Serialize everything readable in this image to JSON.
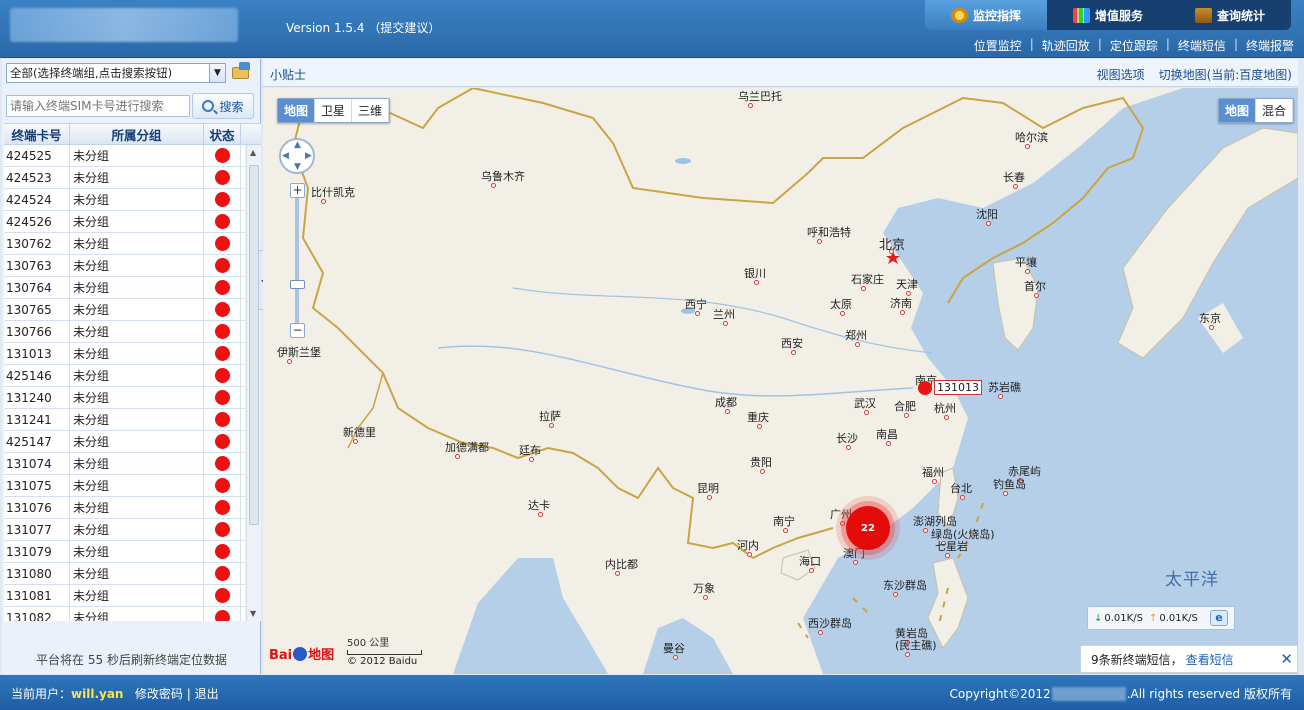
{
  "header": {
    "version": "Version 1.5.4",
    "suggest": "（提交建议）",
    "tabs": [
      {
        "label": "监控指挥",
        "icon": "monitor-icon",
        "active": true
      },
      {
        "label": "增值服务",
        "icon": "chart-icon"
      },
      {
        "label": "查询统计",
        "icon": "briefcase-icon"
      }
    ],
    "subnav": [
      "位置监控",
      "轨迹回放",
      "定位跟踪",
      "终端短信",
      "终端报警"
    ]
  },
  "sidebar": {
    "group_select": "全部(选择终端组,点击搜索按钮)",
    "search_placeholder": "请输入终端SIM卡号进行搜索",
    "search_btn": "搜索",
    "columns": [
      "终端卡号",
      "所属分组",
      "状态"
    ],
    "rows": [
      {
        "id": "424525",
        "group": "未分组"
      },
      {
        "id": "424523",
        "group": "未分组"
      },
      {
        "id": "424524",
        "group": "未分组"
      },
      {
        "id": "424526",
        "group": "未分组"
      },
      {
        "id": "130762",
        "group": "未分组"
      },
      {
        "id": "130763",
        "group": "未分组"
      },
      {
        "id": "130764",
        "group": "未分组"
      },
      {
        "id": "130765",
        "group": "未分组"
      },
      {
        "id": "130766",
        "group": "未分组"
      },
      {
        "id": "131013",
        "group": "未分组"
      },
      {
        "id": "425146",
        "group": "未分组"
      },
      {
        "id": "131240",
        "group": "未分组"
      },
      {
        "id": "131241",
        "group": "未分组"
      },
      {
        "id": "425147",
        "group": "未分组"
      },
      {
        "id": "131074",
        "group": "未分组"
      },
      {
        "id": "131075",
        "group": "未分组"
      },
      {
        "id": "131076",
        "group": "未分组"
      },
      {
        "id": "131077",
        "group": "未分组"
      },
      {
        "id": "131079",
        "group": "未分组"
      },
      {
        "id": "131080",
        "group": "未分组"
      },
      {
        "id": "131081",
        "group": "未分组"
      },
      {
        "id": "131082",
        "group": "未分组"
      }
    ],
    "status_color": "#ee1111",
    "refresh_msg": "平台将在 55 秒后刷新终端定位数据"
  },
  "mapbar": {
    "tips": "小贴士",
    "view_options": "视图选项",
    "switch_map": "切换地图(当前:百度地图)"
  },
  "map": {
    "type_left": [
      "地图",
      "卫星",
      "三维"
    ],
    "type_right": [
      "地图",
      "混合"
    ],
    "cities": [
      "乌兰巴托",
      "乌鲁木齐",
      "比什凯克",
      "伊斯兰堡",
      "新德里",
      "加德满都",
      "廷布",
      "达卡",
      "内比都",
      "万象",
      "河内",
      "曼谷",
      "拉萨",
      "西宁",
      "兰州",
      "银川",
      "呼和浩特",
      "北京",
      "天津",
      "石家庄",
      "太原",
      "济南",
      "郑州",
      "西安",
      "成都",
      "重庆",
      "贵阳",
      "昆明",
      "南宁",
      "广州",
      "澳门",
      "海口",
      "长沙",
      "武汉",
      "南昌",
      "合肥",
      "南京",
      "杭州",
      "福州",
      "台北",
      "澎湖列岛",
      "绿岛(火烧岛)",
      "七星岩",
      "赤尾屿",
      "钓鱼岛",
      "东沙群岛",
      "西沙群岛",
      "黄岩岛",
      "(民主礁)",
      "苏岩礁",
      "沈阳",
      "长春",
      "哈尔滨",
      "平壤",
      "首尔",
      "东京",
      "太平洋"
    ],
    "marker_label": "131013",
    "cluster_count": "22",
    "scale": "500 公里",
    "copyright": "© 2012 Baidu",
    "logo": "Bai 地图",
    "speed_down": "0.01K/S",
    "speed_up": "0.01K/S",
    "notify_text": "9条新终端短信，",
    "notify_link": "查看短信"
  },
  "footer": {
    "user_label": "当前用户：",
    "username": "will.yan",
    "change_pwd": "修改密码",
    "logout": "退出",
    "copyright_pre": "Copyright©2012",
    "copyright_post": ".All rights reserved 版权所有"
  }
}
